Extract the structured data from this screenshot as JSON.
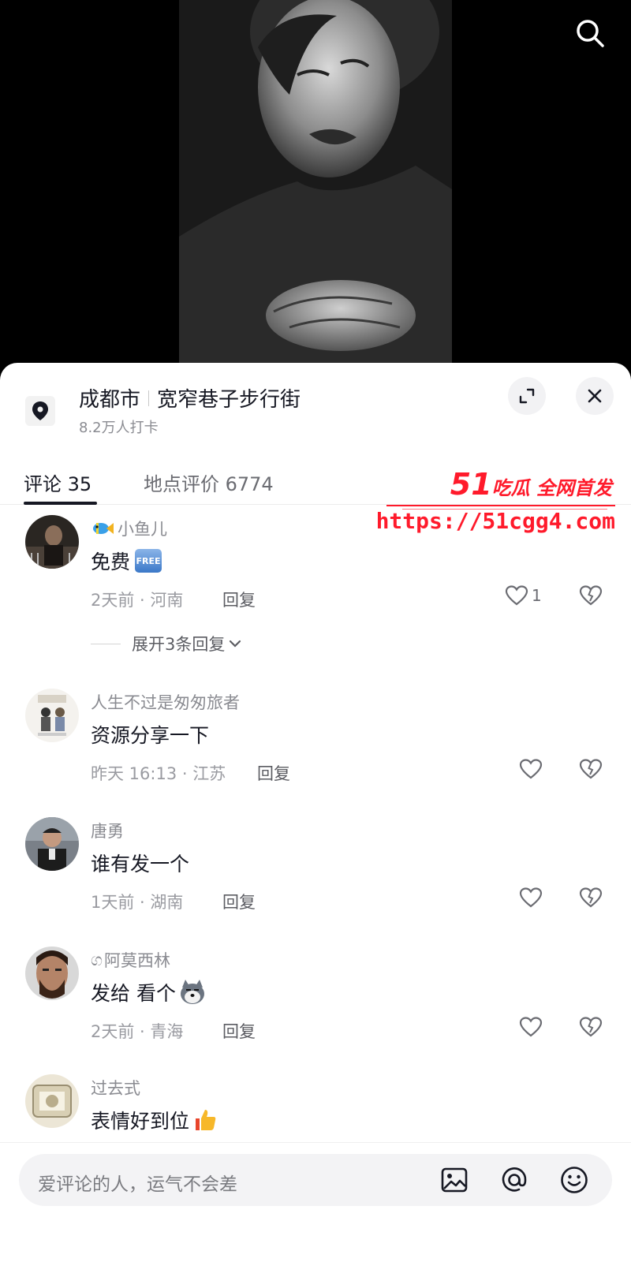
{
  "location": {
    "city": "成都市",
    "place": "宽窄巷子步行街",
    "checkins": "8.2万人打卡"
  },
  "tabs": [
    {
      "label": "评论 35",
      "active": true
    },
    {
      "label": "地点评价 6774",
      "active": false
    }
  ],
  "watermark": {
    "brand_num": "51",
    "brand_text": "吃瓜 全网首发",
    "url": "https://51cgg4.com",
    "color": "#ff1a2b"
  },
  "comments": [
    {
      "user": "小鱼儿",
      "user_icon": "fish-emoji-icon",
      "text": "免费",
      "text_badge": "FREE",
      "meta": "2天前 · 河南",
      "reply": "回复",
      "likes": "1",
      "expand": "展开3条回复"
    },
    {
      "user": "人生不过是匆匆旅者",
      "text": "资源分享一下",
      "meta": "昨天 16:13 · 江苏",
      "reply": "回复"
    },
    {
      "user": "唐勇",
      "text": "谁有发一个",
      "meta": "1天前 · 湖南",
      "reply": "回复"
    },
    {
      "user": "阿莫西林",
      "user_prefix": "ග",
      "text": "发给 看个",
      "text_icon": "husky-emoji-icon",
      "meta": "2天前 · 青海",
      "reply": "回复"
    },
    {
      "user": "过去式",
      "text": "表情好到位",
      "text_icon": "thumbs-up-emoji-icon"
    }
  ],
  "input": {
    "placeholder": "爱评论的人，运气不会差"
  },
  "colors": {
    "text_primary": "#161823",
    "text_secondary": "#8a8b91",
    "sheet_bg": "#ffffff",
    "input_bg": "#f3f3f5"
  }
}
